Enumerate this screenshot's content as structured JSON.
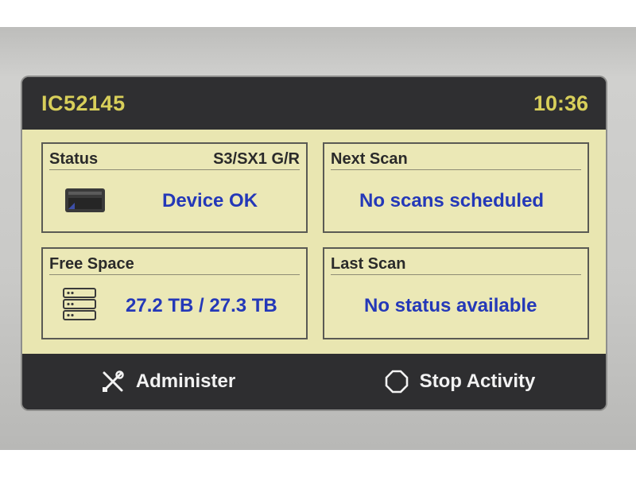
{
  "header": {
    "device_id": "IC52145",
    "time": "10:36"
  },
  "panels": {
    "status": {
      "title": "Status",
      "meta": "S3/SX1 G/R",
      "value": "Device OK",
      "icon": "device-icon"
    },
    "next_scan": {
      "title": "Next Scan",
      "value": "No scans scheduled"
    },
    "free_space": {
      "title": "Free Space",
      "value": "27.2 TB / 27.3 TB",
      "icon": "storage-icon"
    },
    "last_scan": {
      "title": "Last Scan",
      "value": "No status available"
    }
  },
  "footer": {
    "administer_label": "Administer",
    "administer_icon": "tools-icon",
    "stop_label": "Stop Activity",
    "stop_icon": "octagon-stop-icon"
  },
  "colors": {
    "header_text": "#d8cf5a",
    "panel_bg": "#ebe8b6",
    "value_text": "#2438b8",
    "footer_bg": "#2e2e30"
  }
}
